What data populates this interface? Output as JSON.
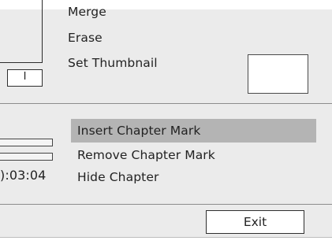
{
  "menu_top": {
    "items": [
      {
        "label": "Merge"
      },
      {
        "label": "Erase"
      },
      {
        "label": "Set Thumbnail"
      }
    ]
  },
  "preview_counter": "I",
  "menu_chapter": {
    "items": [
      {
        "label": "Insert Chapter Mark",
        "selected": true
      },
      {
        "label": "Remove Chapter Mark",
        "selected": false
      },
      {
        "label": "Hide Chapter",
        "selected": false
      }
    ]
  },
  "timecode": "):03:04",
  "exit_button": {
    "label": "Exit"
  },
  "colors": {
    "panel": "#ebebeb",
    "highlight": "#b4b4b4",
    "divider": "#8c8c8c"
  }
}
